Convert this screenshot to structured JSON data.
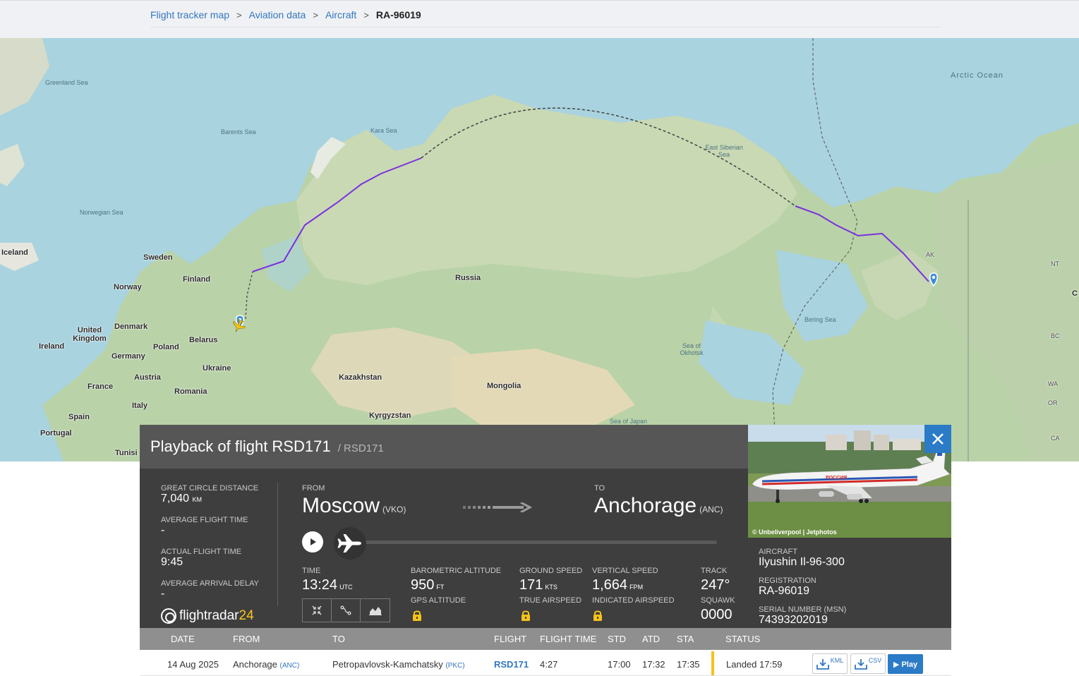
{
  "breadcrumb": {
    "items": [
      "Flight tracker map",
      "Aviation data",
      "Aircraft"
    ],
    "separator": ">",
    "current": "RA-96019"
  },
  "map": {
    "labels": {
      "greenland_sea": "Greenland Sea",
      "barents_sea": "Barents Sea",
      "kara_sea": "Kara Sea",
      "east_siberian_sea": "East Siberian Sea",
      "arctic_ocean": "Arctic Ocean",
      "norwegian_sea": "Norwegian Sea",
      "iceland": "Iceland",
      "sweden": "Sweden",
      "finland": "Finland",
      "norway": "Norway",
      "russia": "Russia",
      "united_kingdom": "United Kingdom",
      "denmark": "Denmark",
      "ireland": "Ireland",
      "belarus": "Belarus",
      "poland": "Poland",
      "germany": "Germany",
      "ukraine": "Ukraine",
      "france": "France",
      "austria": "Austria",
      "romania": "Romania",
      "kazakhstan": "Kazakhstan",
      "mongolia": "Mongolia",
      "italy": "Italy",
      "spain": "Spain",
      "portugal": "Portugal",
      "kyrgyzstan": "Kyrgyzstan",
      "tunisia": "Tunisi",
      "bering_sea": "Bering Sea",
      "sea_of_okhotsk": "Sea of Okhotsk",
      "sea_of_japan": "Sea of Japan",
      "ak": "AK",
      "nt": "NT",
      "bc": "BC",
      "wa": "WA",
      "or": "OR",
      "ca": "CA",
      "ca_edge": "C"
    }
  },
  "panel": {
    "title": "Playback of flight RSD171",
    "subtitle": "/ RSD171",
    "stats": [
      {
        "label": "GREAT CIRCLE DISTANCE",
        "value": "7,040",
        "unit": "KM"
      },
      {
        "label": "AVERAGE FLIGHT TIME",
        "value": "-",
        "unit": ""
      },
      {
        "label": "ACTUAL FLIGHT TIME",
        "value": "9:45",
        "unit": ""
      },
      {
        "label": "AVERAGE ARRIVAL DELAY",
        "value": "-",
        "unit": ""
      }
    ],
    "logo_text": "flightradar",
    "logo_num": "24",
    "from_label": "FROM",
    "from_city": "Moscow",
    "from_code": "(VKO)",
    "to_label": "TO",
    "to_city": "Anchorage",
    "to_code": "(ANC)",
    "time_label": "TIME",
    "time_value": "13:24",
    "time_unit": "UTC",
    "baro_label": "BAROMETRIC ALTITUDE",
    "baro_value": "950",
    "baro_unit": "FT",
    "gps_label": "GPS ALTITUDE",
    "gs_label": "GROUND SPEED",
    "gs_value": "171",
    "gs_unit": "KTS",
    "tas_label": "TRUE AIRSPEED",
    "vs_label": "VERTICAL SPEED",
    "vs_value": "1,664",
    "vs_unit": "FPM",
    "ias_label": "INDICATED AIRSPEED",
    "track_label": "TRACK",
    "track_value": "247°",
    "squawk_label": "SQUAWK",
    "squawk_value": "0000"
  },
  "aircraft": {
    "photo_credit": "© Unbeliverpool | Jetphotos",
    "aircraft_label": "AIRCRAFT",
    "aircraft_value": "Ilyushin Il-96-300",
    "registration_label": "REGISTRATION",
    "registration_value": "RA-96019",
    "serial_label": "SERIAL NUMBER (MSN)",
    "serial_value": "74393202019",
    "livery_text": "РОССИЯ"
  },
  "table": {
    "headers": [
      "DATE",
      "FROM",
      "TO",
      "FLIGHT",
      "FLIGHT TIME",
      "STD",
      "ATD",
      "STA",
      "STATUS"
    ],
    "rows": [
      {
        "date": "14 Aug 2025",
        "from": "Anchorage",
        "from_code": "(ANC)",
        "to": "Petropavlovsk-Kamchatsky",
        "to_code": "(PKC)",
        "flight": "RSD171",
        "flight_time": "4:27",
        "std": "17:00",
        "atd": "17:32",
        "sta": "17:35",
        "status": "Landed 17:59",
        "kml": "KML",
        "csv": "CSV",
        "play": "▶ Play"
      }
    ]
  },
  "colors": {
    "link": "#3277c0",
    "panel_bg": "#3e3e3e",
    "route_purple": "#7b2fe0",
    "status_yellow": "#f4c21a",
    "close_blue": "#2b7bc6"
  }
}
